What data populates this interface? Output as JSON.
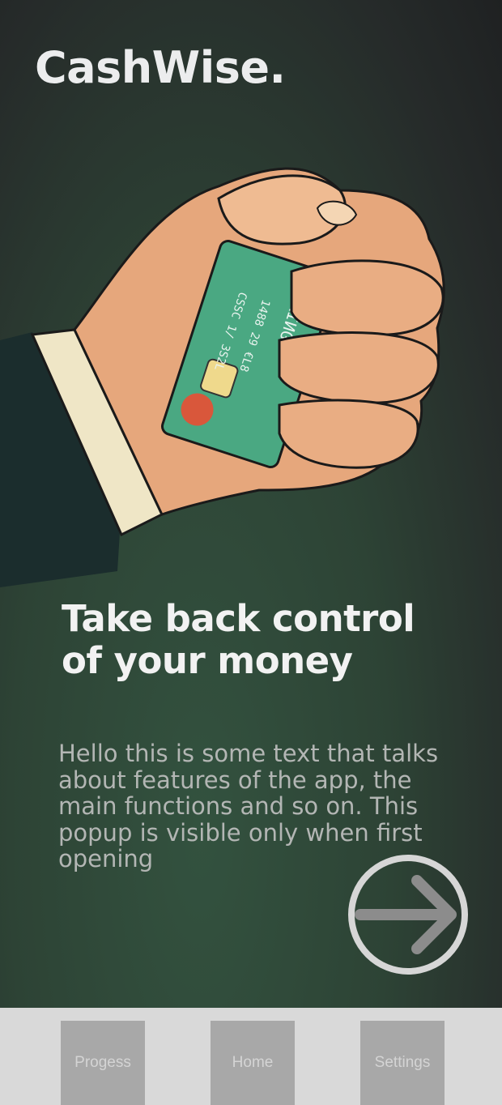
{
  "app": {
    "title": "CashWise."
  },
  "hero": {
    "card_text_1": "ORIИG",
    "card_text_2": "1488 29 €L8",
    "card_text_3": "CSSC 1/ 3S2L"
  },
  "onboarding": {
    "headline": "Take back control of your money",
    "body": "Hello this is some text that talks about features of the app, the main functions and so on. This popup is visible only when first opening"
  },
  "next_button": {
    "icon": "arrow-right-icon"
  },
  "nav": {
    "items": [
      {
        "label": "Progess"
      },
      {
        "label": "Home"
      },
      {
        "label": "Settings"
      }
    ]
  },
  "colors": {
    "accent_card": "#4aa882",
    "background": "#2d4335",
    "nav_bar": "#d9d9d9",
    "nav_button": "#a8a8a8"
  }
}
